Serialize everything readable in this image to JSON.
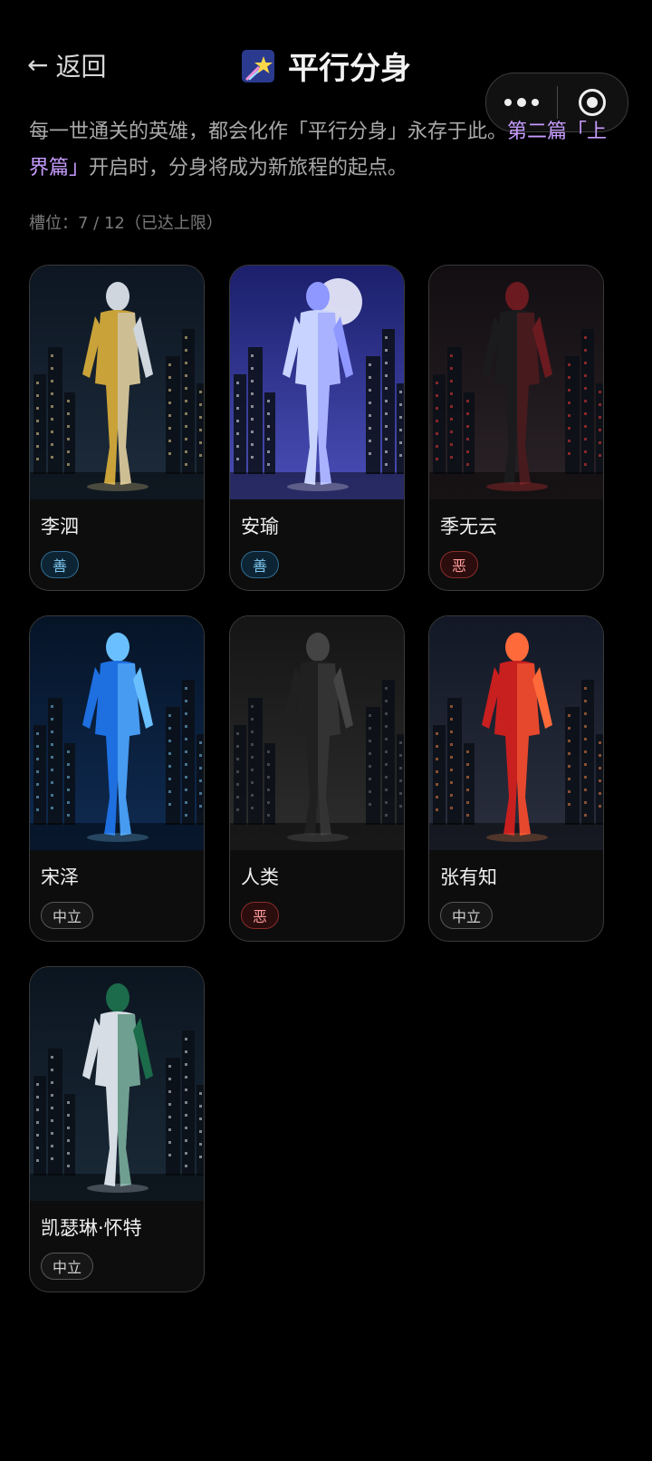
{
  "header": {
    "back_label": "返回",
    "title": "平行分身",
    "title_icon": "shooting-star-icon"
  },
  "capsule": {
    "more_icon": "more-dots-icon",
    "close_icon": "target-icon"
  },
  "intro": {
    "text_before": "每一世通关的英雄，都会化作「平行分身」永存于此。",
    "highlight": "第二篇「上界篇」",
    "text_after": "开启时，分身将成为新旅程的起点。",
    "highlight_color": "#c79cff"
  },
  "slots_text": "槽位：7 / 12（已达上限）",
  "cards": [
    {
      "name": "李泗",
      "alignment": "善",
      "tone": "good",
      "art": "gold-silver-armored-hero"
    },
    {
      "name": "安瑜",
      "alignment": "善",
      "tone": "good",
      "art": "moonlit-ice-maiden"
    },
    {
      "name": "季无云",
      "alignment": "恶",
      "tone": "evil",
      "art": "dark-coat-swordsman"
    },
    {
      "name": "宋泽",
      "alignment": "中立",
      "tone": "neutral",
      "art": "blue-lightning-hero"
    },
    {
      "name": "人类",
      "alignment": "恶",
      "tone": "evil",
      "art": "black-armored-creature"
    },
    {
      "name": "张有知",
      "alignment": "中立",
      "tone": "neutral",
      "art": "red-suited-heroine"
    },
    {
      "name": "凯瑟琳·怀特",
      "alignment": "中立",
      "tone": "neutral",
      "art": "silver-green-armored-heroine"
    }
  ],
  "colors": {
    "good": "#7fc6ee",
    "evil": "#ff9b9b",
    "neutral": "#cfcfcf"
  }
}
